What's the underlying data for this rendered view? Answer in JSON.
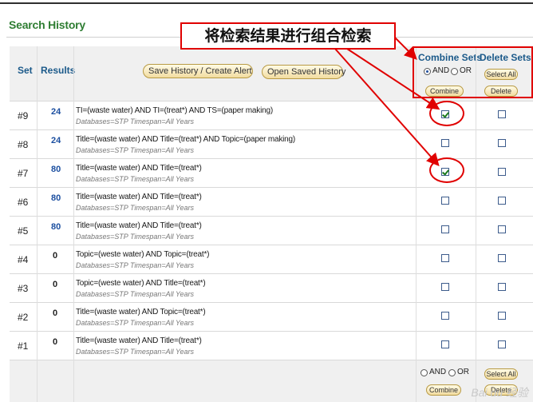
{
  "page_title": "Search History",
  "header": {
    "set_label": "Set",
    "results_label": "Results",
    "save_button": "Save History / Create Alert",
    "open_button": "Open Saved History",
    "combine_title": "Combine Sets",
    "delete_title": "Delete Sets",
    "and_label": "AND",
    "or_label": "OR",
    "and_selected": true,
    "combine_button": "Combine",
    "select_all_button": "Select All",
    "delete_button": "Delete"
  },
  "annotation": {
    "note_text": "将检索结果进行组合检索",
    "color": "#e00000"
  },
  "rows": [
    {
      "set": "#9",
      "results": "24",
      "query": "TI=(waste water) AND TI=(treat*) AND TS=(paper making)",
      "databases": "Databases=STP Timespan=All Years",
      "combine_checked": true,
      "delete_checked": false
    },
    {
      "set": "#8",
      "results": "24",
      "query": "Title=(waste water) AND Title=(treat*) AND Topic=(paper making)",
      "databases": "Databases=STP Timespan=All Years",
      "combine_checked": false,
      "delete_checked": false
    },
    {
      "set": "#7",
      "results": "80",
      "query": "Title=(waste water) AND Title=(treat*)",
      "databases": "Databases=STP Timespan=All Years",
      "combine_checked": true,
      "delete_checked": false
    },
    {
      "set": "#6",
      "results": "80",
      "query": "Title=(waste water) AND Title=(treat*)",
      "databases": "Databases=STP Timespan=All Years",
      "combine_checked": false,
      "delete_checked": false
    },
    {
      "set": "#5",
      "results": "80",
      "query": "Title=(waste water) AND Title=(treat*)",
      "databases": "Databases=STP Timespan=All Years",
      "combine_checked": false,
      "delete_checked": false
    },
    {
      "set": "#4",
      "results": "0",
      "query": "Topic=(weste water) AND Topic=(treat*)",
      "databases": "Databases=STP Timespan=All Years",
      "combine_checked": false,
      "delete_checked": false
    },
    {
      "set": "#3",
      "results": "0",
      "query": "Topic=(weste water) AND Title=(treat*)",
      "databases": "Databases=STP Timespan=All Years",
      "combine_checked": false,
      "delete_checked": false
    },
    {
      "set": "#2",
      "results": "0",
      "query": "Title=(waste water) AND Topic=(treat*)",
      "databases": "Databases=STP Timespan=All Years",
      "combine_checked": false,
      "delete_checked": false
    },
    {
      "set": "#1",
      "results": "0",
      "query": "Title=(waste water) AND Title=(treat*)",
      "databases": "Databases=STP Timespan=All Years",
      "combine_checked": false,
      "delete_checked": false
    }
  ],
  "footer": {
    "and_label": "AND",
    "or_label": "OR",
    "and_selected": false,
    "combine_button": "Combine",
    "select_all_button": "Select All",
    "delete_button": "Delete"
  },
  "watermark_text": "Bai du 经验"
}
